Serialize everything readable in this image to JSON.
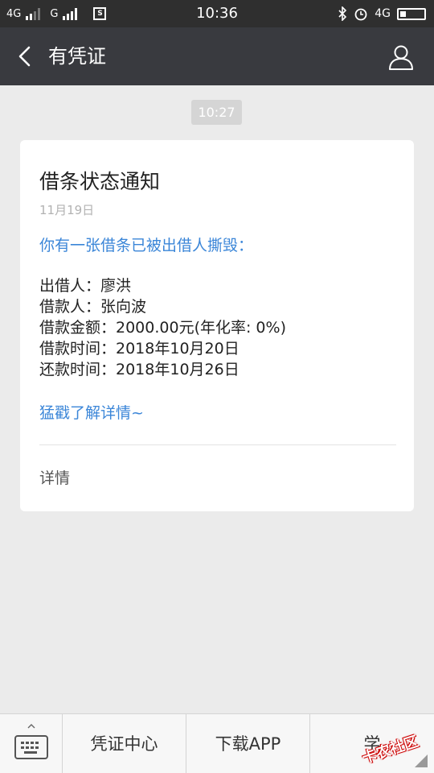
{
  "status_bar": {
    "network1": "4G",
    "network2": "G",
    "time": "10:36",
    "right_network": "4G"
  },
  "titlebar": {
    "title": "有凭证"
  },
  "message": {
    "time": "10:27",
    "card": {
      "title": "借条状态通知",
      "date": "11月19日",
      "intro": "你有一张借条已被出借人撕毁：",
      "details": [
        "出借人：廖洪",
        "借款人：张向波",
        "借款金额：2000.00元(年化率: 0%)",
        "借款时间：2018年10月20日",
        "还款时间：2018年10月26日"
      ],
      "more_link": "猛戳了解详情~",
      "footer_link": "详情"
    }
  },
  "bottom_bar": {
    "items": [
      "凭证中心",
      "下载APP",
      "学"
    ],
    "watermark": "卡农社区"
  },
  "colors": {
    "accent_blue": "#3b86d8",
    "titlebar_bg": "#393a3f",
    "page_bg": "#ebebeb"
  }
}
